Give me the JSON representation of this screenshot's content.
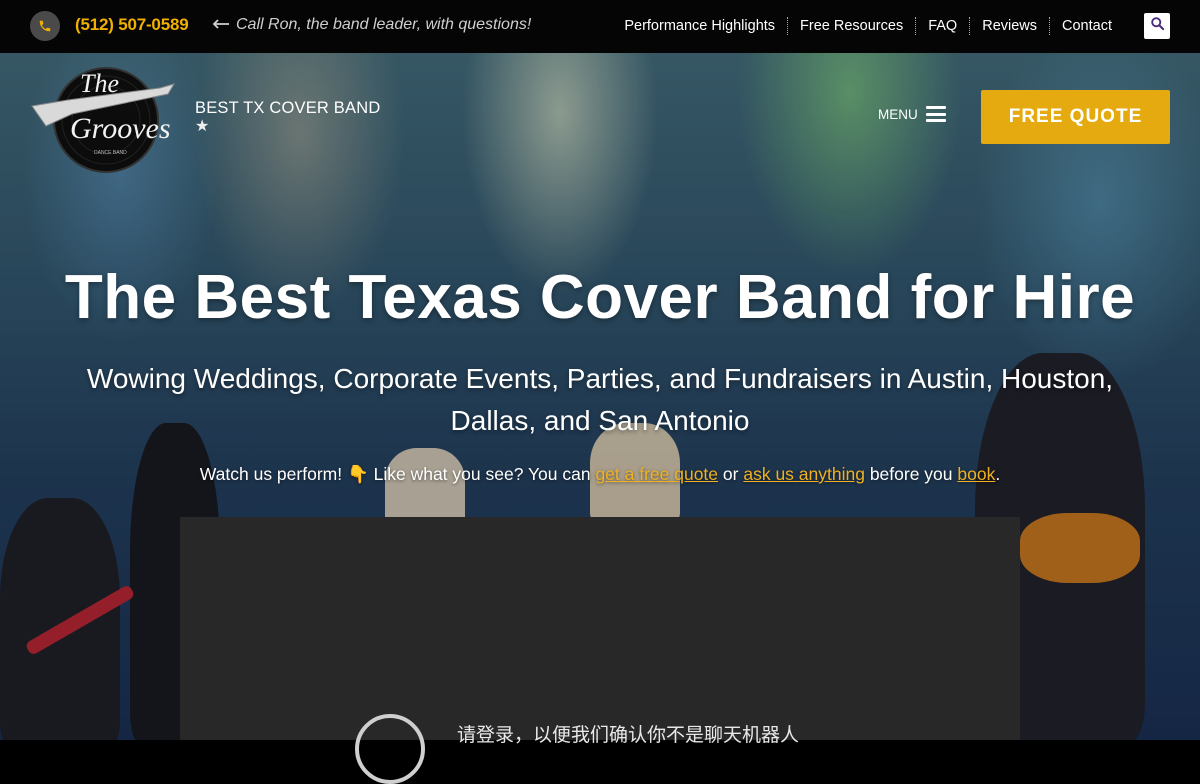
{
  "topbar": {
    "phone": "(512) 507-0589",
    "call_note": "Call Ron, the band leader, with questions!",
    "nav": [
      "Performance Highlights",
      "Free Resources",
      "FAQ",
      "Reviews",
      "Contact"
    ]
  },
  "header": {
    "logo_text": "The Grooves",
    "tagline": "BEST TX COVER BAND",
    "menu_label": "MENU",
    "quote_button": "FREE QUOTE"
  },
  "hero": {
    "headline": "The Best Texas Cover Band for Hire",
    "subheadline": "Wowing Weddings, Corporate Events, Parties, and Fundraisers in Austin, Houston, Dallas, and San Antonio",
    "perform_prefix": "Watch us perform! 👇 Like what you see? You can ",
    "link_quote": "get a free quote",
    "mid1": " or ",
    "link_ask": "ask us anything",
    "mid2": " before you ",
    "link_book": "book",
    "suffix": "."
  },
  "video": {
    "message": "请登录，以便我们确认你不是聊天机器人"
  },
  "colors": {
    "accent": "#e5aa10",
    "topbar_bg": "#050505",
    "video_bg": "#282828"
  }
}
